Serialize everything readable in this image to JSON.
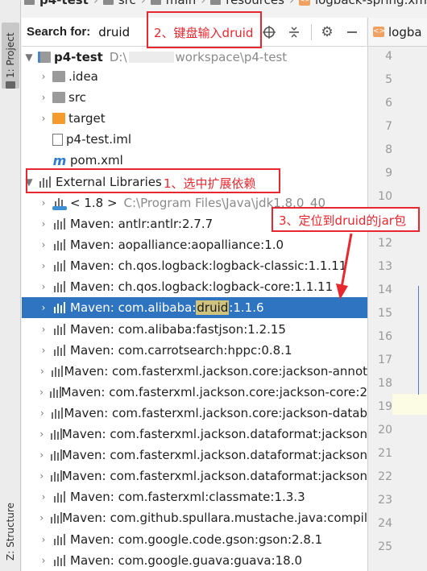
{
  "breadcrumb": [
    "p4-test",
    "src",
    "main",
    "resources",
    "logback-spring.xml"
  ],
  "tool_window_tabs": {
    "project": "1: Project",
    "structure": "Z: Structure"
  },
  "search": {
    "label": "Search for:",
    "value": "druid"
  },
  "editor": {
    "tab_label": "logba",
    "line_numbers": [
      "4",
      "5",
      "6",
      "7",
      "8",
      "9",
      "10",
      "11",
      "12",
      "13",
      "14",
      "15",
      "16",
      "17",
      "18",
      "19",
      "20",
      "21",
      "22",
      "23",
      "24",
      "25"
    ]
  },
  "tree": {
    "project": {
      "name": "p4-test",
      "path": "D:\\",
      "path_tail": "workspace\\p4-test"
    },
    "items": [
      {
        "label": ".idea",
        "icon": "folder-icon"
      },
      {
        "label": "src",
        "icon": "folder-icon"
      },
      {
        "label": "target",
        "icon": "folder-orange-icon"
      },
      {
        "label": "p4-test.iml",
        "icon": "iml-file-icon"
      },
      {
        "label": "pom.xml",
        "icon": "maven-pom-icon"
      }
    ],
    "external_libraries": "External Libraries",
    "jdk": {
      "label": "< 1.8 >",
      "path": "C:\\Program Files\\Java\\jdk1.8.0_40"
    },
    "libraries": [
      "Maven: antlr:antlr:2.7.7",
      "Maven: aopalliance:aopalliance:1.0",
      "Maven: ch.qos.logback:logback-classic:1.1.11",
      "Maven: ch.qos.logback:logback-core:1.1.11",
      "Maven: com.alibaba:",
      "Maven: com.alibaba:fastjson:1.2.15",
      "Maven: com.carrotsearch:hppc:0.8.1",
      "Maven: com.fasterxml.jackson.core:jackson-annot",
      "Maven: com.fasterxml.jackson.core:jackson-core:2",
      "Maven: com.fasterxml.jackson.core:jackson-datab",
      "Maven: com.fasterxml.jackson.dataformat:jackson",
      "Maven: com.fasterxml.jackson.dataformat:jackson",
      "Maven: com.fasterxml.jackson.dataformat:jackson",
      "Maven: com.fasterxml:classmate:1.3.3",
      "Maven: com.github.spullara.mustache.java:compil",
      "Maven: com.google.code.gson:gson:2.8.1",
      "Maven: com.google.guava:guava:18.0"
    ],
    "selected_library": {
      "prefix": "Maven: com.alibaba:",
      "match": "druid",
      "suffix": ":1.1.6"
    }
  },
  "annotations": {
    "step1": "1、选中扩展依赖",
    "step2": "2、键盘输入druid",
    "step3": "3、定位到druid的jar包",
    "color": "#e8272e"
  },
  "colors": {
    "selection": "#2f74c0",
    "match_highlight": "#cfc27c"
  }
}
